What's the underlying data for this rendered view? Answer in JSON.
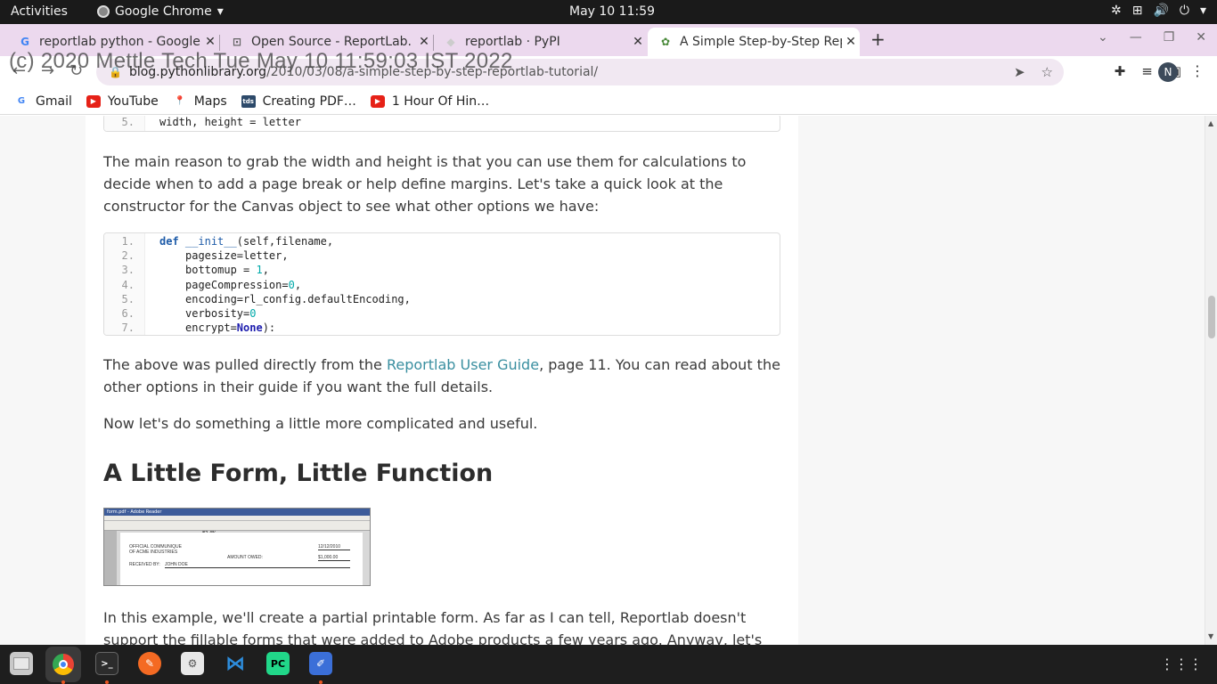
{
  "topbar": {
    "activities": "Activities",
    "app_name": "Google Chrome",
    "clock": "May 10  11:59"
  },
  "tabs": [
    {
      "title": "reportlab python - Google",
      "favicon": "google-icon"
    },
    {
      "title": "Open Source - ReportLab.",
      "favicon": "reportlab-icon"
    },
    {
      "title": "reportlab · PyPI",
      "favicon": "pypi-icon"
    },
    {
      "title": "A Simple Step-by-Step Rep",
      "favicon": "python-library-icon",
      "active": true
    }
  ],
  "toolbar": {
    "url_host": "blog.pythonlibrary.org",
    "url_path": "/2010/03/08/a-simple-step-by-step-reportlab-tutorial/",
    "avatar_initial": "N"
  },
  "watermark": "(c) 2020 Mettle Tech Tue May 10 11:59:03 IST 2022",
  "bookmarks": [
    {
      "label": "Gmail",
      "icon": "google-icon"
    },
    {
      "label": "YouTube",
      "icon": "youtube-icon"
    },
    {
      "label": "Maps",
      "icon": "maps-icon"
    },
    {
      "label": "Creating PDF…",
      "icon": "tds-icon",
      "icon_text": "tds"
    },
    {
      "label": "1 Hour Of Hin…",
      "icon": "youtube-icon"
    }
  ],
  "article": {
    "code1_line_no": "5.",
    "code1_line": "width, height = letter",
    "para1": "The main reason to grab the width and height is that you can use them for calculations to decide when to add a page break or help define margins. Let's take a quick look at the constructor for the Canvas object to see what other options we have:",
    "code2": {
      "line_numbers": [
        "1.",
        "2.",
        "3.",
        "4.",
        "5.",
        "6.",
        "7."
      ],
      "kw_def": "def",
      "fn_init": "__init__",
      "line1_rest": "(self,filename,",
      "line2": "pagesize=letter,",
      "line3_a": "bottomup = ",
      "line3_num": "1",
      "line3_b": ",",
      "line4_a": "pageCompression=",
      "line4_num": "0",
      "line4_b": ",",
      "line5": "encoding=rl_config.defaultEncoding,",
      "line6_a": "verbosity=",
      "line6_num": "0",
      "line7_a": "encrypt=",
      "line7_none": "None",
      "line7_b": "):"
    },
    "para2_a": "The above was pulled directly from the ",
    "para2_link": "Reportlab User Guide",
    "para2_b": ", page 11. You can read about the other options in their guide if you want the full details.",
    "para3": "Now let's do something a little more complicated and useful.",
    "heading": "A Little Form, Little Function",
    "thumb": {
      "window_title": "form.pdf - Adobe Reader",
      "zoom": "82.4%",
      "line1": "OFFICIAL COMMUNIQUE",
      "line2": "OF ACME INDUSTRIES",
      "date": "12/12/2010",
      "amount_label": "AMOUNT OWED:",
      "amount": "$1,000.00",
      "received_label": "RECEIVED BY:",
      "received_name": "JOHN DOE"
    },
    "para4": "In this example, we'll create a partial printable form. As far as I can tell, Reportlab doesn't support the fillable forms that were added to Adobe products a few years ago. Anyway, let's take a look at some"
  }
}
